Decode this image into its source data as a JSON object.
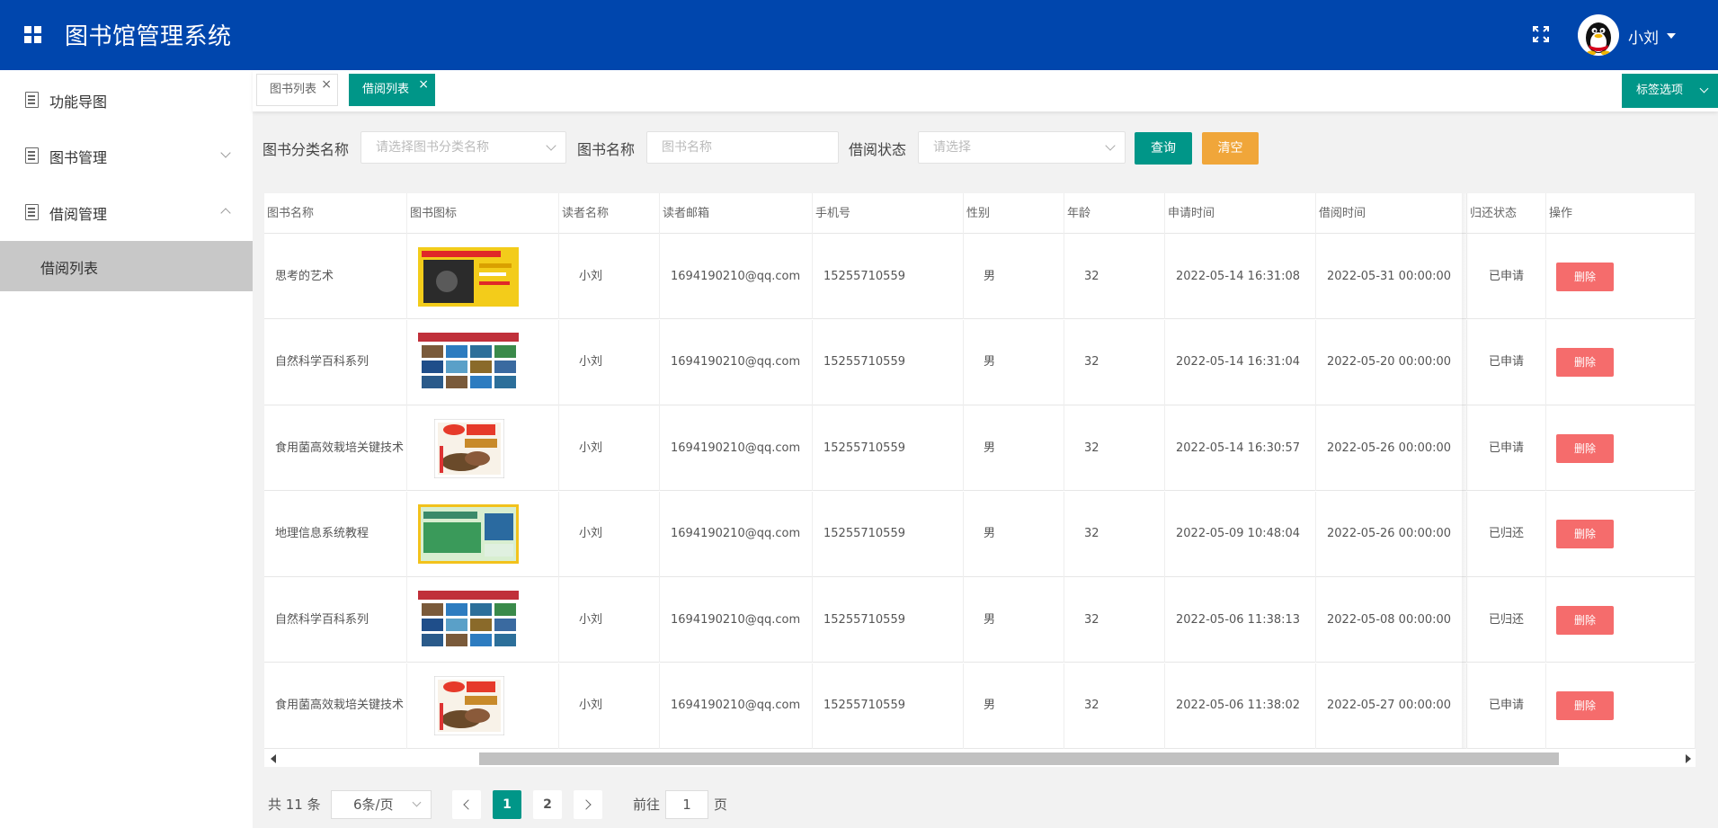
{
  "header": {
    "title": "图书馆管理系统",
    "user_name": "小刘",
    "icons": [
      "grid-icon",
      "fullscreen-icon",
      "avatar"
    ]
  },
  "sidebar": {
    "items": [
      {
        "label": "功能导图",
        "icon": "document-icon"
      },
      {
        "label": "图书管理",
        "icon": "document-icon",
        "expandable": true
      },
      {
        "label": "借阅管理",
        "icon": "document-icon",
        "expanded": true
      }
    ],
    "sub_items": [
      {
        "label": "借阅列表",
        "active": true
      }
    ]
  },
  "tags": {
    "items": [
      {
        "label": "图书列表",
        "active": false
      },
      {
        "label": "借阅列表",
        "active": true
      }
    ],
    "options_label": "标签选项"
  },
  "search": {
    "category_label": "图书分类名称",
    "category_placeholder": "请选择图书分类名称",
    "name_label": "图书名称",
    "name_placeholder": "图书名称",
    "status_label": "借阅状态",
    "status_placeholder": "请选择",
    "query_button": "查询",
    "clear_button": "清空"
  },
  "table": {
    "columns": [
      "图书名称",
      "图书图标",
      "读者名称",
      "读者邮箱",
      "手机号",
      "性别",
      "年龄",
      "申请时间",
      "借阅时间",
      "归还状态",
      "操作"
    ],
    "delete_label": "删除",
    "rows": [
      {
        "book": "思考的艺术",
        "cover": "yellow",
        "reader": "小刘",
        "email": "1694190210@qq.com",
        "phone": "15255710559",
        "gender": "男",
        "age": "32",
        "apply_time": "2022-05-14 16:31:08",
        "borrow_time": "2022-05-31 00:00:00",
        "status": "已申请"
      },
      {
        "book": "自然科学百科系列",
        "cover": "science",
        "reader": "小刘",
        "email": "1694190210@qq.com",
        "phone": "15255710559",
        "gender": "男",
        "age": "32",
        "apply_time": "2022-05-14 16:31:04",
        "borrow_time": "2022-05-20 00:00:00",
        "status": "已申请"
      },
      {
        "book": "食用菌高效栽培关键技术",
        "cover": "mushroom",
        "reader": "小刘",
        "email": "1694190210@qq.com",
        "phone": "15255710559",
        "gender": "男",
        "age": "32",
        "apply_time": "2022-05-14 16:30:57",
        "borrow_time": "2022-05-26 00:00:00",
        "status": "已申请"
      },
      {
        "book": "地理信息系统教程",
        "cover": "gis",
        "reader": "小刘",
        "email": "1694190210@qq.com",
        "phone": "15255710559",
        "gender": "男",
        "age": "32",
        "apply_time": "2022-05-09 10:48:04",
        "borrow_time": "2022-05-26 00:00:00",
        "status": "已归还"
      },
      {
        "book": "自然科学百科系列",
        "cover": "science",
        "reader": "小刘",
        "email": "1694190210@qq.com",
        "phone": "15255710559",
        "gender": "男",
        "age": "32",
        "apply_time": "2022-05-06 11:38:13",
        "borrow_time": "2022-05-08 00:00:00",
        "status": "已归还"
      },
      {
        "book": "食用菌高效栽培关键技术",
        "cover": "mushroom",
        "reader": "小刘",
        "email": "1694190210@qq.com",
        "phone": "15255710559",
        "gender": "男",
        "age": "32",
        "apply_time": "2022-05-06 11:38:02",
        "borrow_time": "2022-05-27 00:00:00",
        "status": "已申请"
      }
    ]
  },
  "pagination": {
    "total_text": "共 11 条",
    "page_size": "6条/页",
    "pages": [
      "1",
      "2"
    ],
    "current_page": "1",
    "goto_label": "前往",
    "goto_value": "1",
    "page_unit": "页"
  },
  "colors": {
    "header": "#0046ad",
    "primary": "#009688",
    "warning": "#f0a63a",
    "danger": "#f56c6c"
  }
}
